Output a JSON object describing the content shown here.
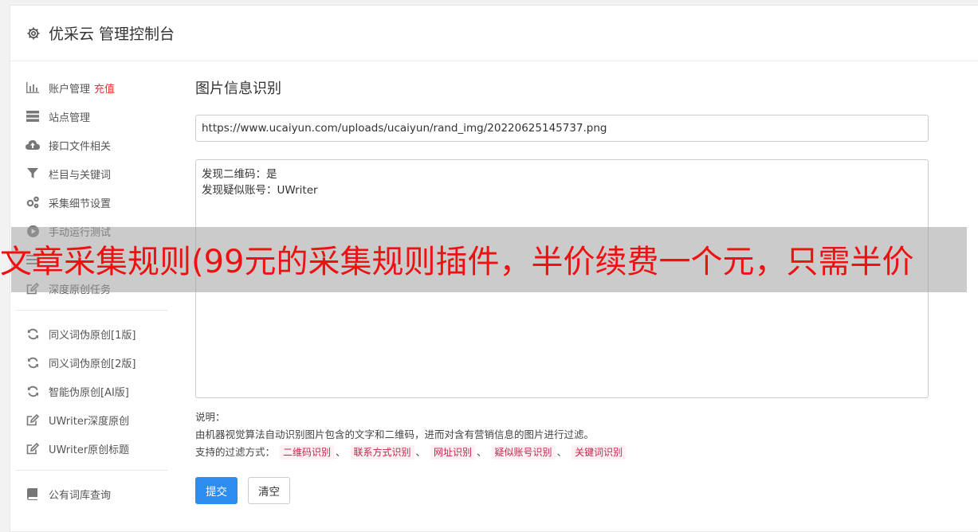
{
  "header": {
    "title": "优采云 管理控制台",
    "icon": "gear-icon"
  },
  "sidebar": {
    "groups": [
      [
        {
          "label": "账户管理",
          "badge": "充值",
          "icon": "bar-chart-icon"
        },
        {
          "label": "站点管理",
          "icon": "server-icon"
        },
        {
          "label": "接口文件相关",
          "icon": "cloud-upload-icon"
        },
        {
          "label": "栏目与关键词",
          "icon": "filter-icon"
        },
        {
          "label": "采集细节设置",
          "icon": "gears-icon"
        },
        {
          "label": "手动运行测试",
          "icon": "play-circle-icon"
        },
        {
          "label": "",
          "icon": "list-icon"
        },
        {
          "label": "深度原创任务",
          "icon": "edit-icon"
        }
      ],
      [
        {
          "label": "同义词伪原创[1版]",
          "icon": "refresh-icon"
        },
        {
          "label": "同义词伪原创[2版]",
          "icon": "refresh-icon"
        },
        {
          "label": "智能伪原创[AI版]",
          "icon": "refresh-icon"
        },
        {
          "label": "UWriter深度原创",
          "icon": "edit-icon"
        },
        {
          "label": "UWriter原创标题",
          "icon": "edit-icon"
        }
      ],
      [
        {
          "label": "公有词库查询",
          "icon": "book-icon"
        }
      ]
    ]
  },
  "main": {
    "title": "图片信息识别",
    "url_value": "https://www.ucaiyun.com/uploads/ucaiyun/rand_img/20220625145737.png",
    "result_lines": [
      "发现二维码：是",
      "发现疑似账号：UWriter"
    ],
    "notes_label": "说明：",
    "notes_desc": "由机器视觉算法自动识别图片包含的文字和二维码，进而对含有营销信息的图片进行过滤。",
    "filter_label": "支持的过滤方式：",
    "filter_tags": [
      "二维码识别",
      "联系方式识别",
      "网址识别",
      "疑似账号识别",
      "关键词识别"
    ],
    "tag_separator": "、",
    "submit_label": "提交",
    "clear_label": "清空"
  },
  "banner": {
    "text": "文章采集规则(99元的采集规则插件，半价续费一个元，只需半价"
  },
  "colors": {
    "accent": "#2d8cf0",
    "badge": "#ee3333",
    "banner_text": "#ee1111",
    "tag_bg": "#fdf1f4",
    "tag_text": "#c7254e"
  }
}
